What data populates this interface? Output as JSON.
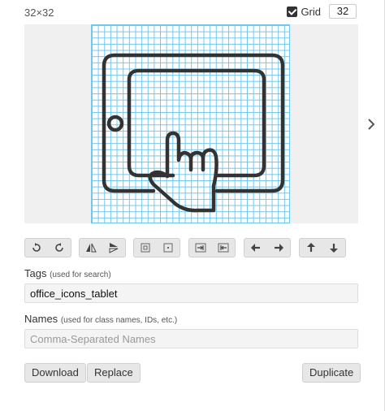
{
  "header": {
    "size_label": "32×32",
    "grid_label": "Grid",
    "grid_value": "32"
  },
  "icon": {
    "name": "tablet-touch-icon"
  },
  "toolbar": {
    "groups": [
      [
        "rotate-ccw-icon",
        "rotate-cw-icon"
      ],
      [
        "flip-horizontal-icon",
        "flip-vertical-icon"
      ],
      [
        "shrink-icon",
        "center-icon"
      ],
      [
        "compress-horizontal-icon",
        "expand-horizontal-icon"
      ],
      [
        "arrow-left-icon",
        "arrow-right-icon"
      ],
      [
        "arrow-up-icon",
        "arrow-down-icon"
      ]
    ]
  },
  "tags": {
    "label": "Tags",
    "hint": "(used for search)",
    "value": "office_icons_tablet"
  },
  "names": {
    "label": "Names",
    "hint": "(used for class names, IDs, etc.)",
    "placeholder": "Comma-Separated Names"
  },
  "buttons": {
    "download": "Download",
    "replace": "Replace",
    "duplicate": "Duplicate"
  }
}
